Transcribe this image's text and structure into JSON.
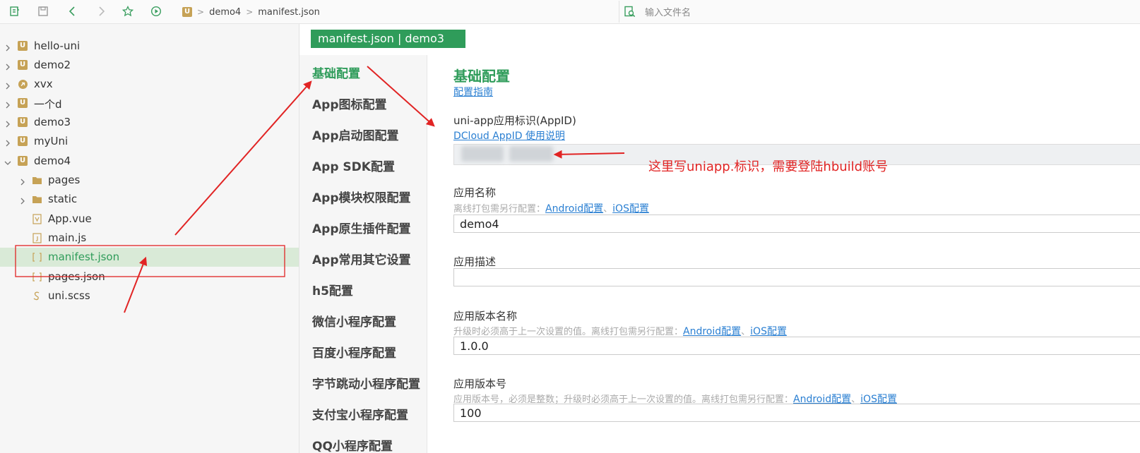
{
  "breadcrumb": {
    "project": "demo4",
    "file": "manifest.json"
  },
  "search": {
    "placeholder": "输入文件名"
  },
  "tree": [
    {
      "label": "hello-uni",
      "icon": "uni-project-icon"
    },
    {
      "label": "demo2",
      "icon": "uni-project-icon"
    },
    {
      "label": "xvx",
      "icon": "link-project-icon"
    },
    {
      "label": "一个d",
      "icon": "uni-project-icon"
    },
    {
      "label": "demo3",
      "icon": "uni-project-icon"
    },
    {
      "label": "myUni",
      "icon": "uni-project-icon"
    },
    {
      "label": "demo4",
      "icon": "uni-project-icon"
    },
    {
      "label": "pages",
      "icon": "folder-icon"
    },
    {
      "label": "static",
      "icon": "folder-icon"
    },
    {
      "label": "App.vue",
      "icon": "vue-file-icon"
    },
    {
      "label": "main.js",
      "icon": "js-file-icon"
    },
    {
      "label": "manifest.json",
      "icon": "json-file-icon"
    },
    {
      "label": "pages.json",
      "icon": "json-file-icon"
    },
    {
      "label": "uni.scss",
      "icon": "scss-file-icon"
    }
  ],
  "tab": {
    "label": "manifest.json | demo3"
  },
  "nav": [
    "基础配置",
    "App图标配置",
    "App启动图配置",
    "App SDK配置",
    "App模块权限配置",
    "App原生插件配置",
    "App常用其它设置",
    "h5配置",
    "微信小程序配置",
    "百度小程序配置",
    "字节跳动小程序配置",
    "支付宝小程序配置",
    "QQ小程序配置"
  ],
  "main": {
    "title": "基础配置",
    "guide_link": "配置指南",
    "appid": {
      "label": "uni-app应用标识(AppID)",
      "link": "DCloud AppID 使用说明"
    },
    "app_name": {
      "label": "应用名称",
      "hint": "离线打包需另行配置：",
      "android_link": "Android配置",
      "sep": "、",
      "ios_link": "iOS配置",
      "value": "demo4"
    },
    "app_desc": {
      "label": "应用描述",
      "value": ""
    },
    "version_name": {
      "label": "应用版本名称",
      "hint": "升级时必须高于上一次设置的值。离线打包需另行配置：",
      "android_link": "Android配置",
      "sep": "、",
      "ios_link": "iOS配置",
      "value": "1.0.0"
    },
    "version_code": {
      "label": "应用版本号",
      "hint": "应用版本号，必须是整数；升级时必须高于上一次设置的值。离线打包需另行配置：",
      "android_link": "Android配置",
      "sep": "、",
      "ios_link": "iOS配置",
      "value": "100"
    }
  },
  "annotation": {
    "text": "这里写uniapp.标识，需要登陆hbuild账号"
  },
  "colors": {
    "accent": "#2f9c5a",
    "link": "#2a7fd2",
    "annotation": "#e12424"
  }
}
